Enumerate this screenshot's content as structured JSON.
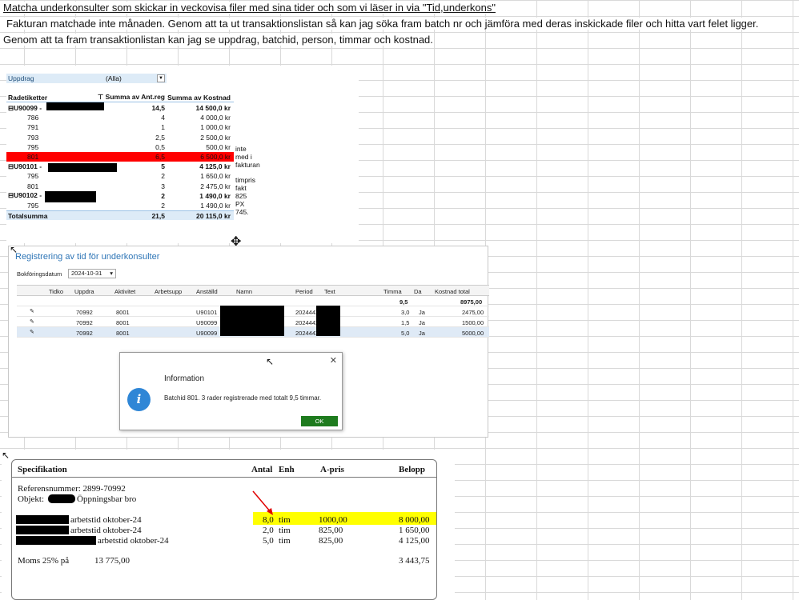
{
  "notes": {
    "line1": "Matcha underkonsulter som skickar  in veckovisa filer med sina tider  och som vi läser in  via \"Tid,underkons\"",
    "line2": "Fakturan matchade inte månaden.  Genom att ta ut transaktionslistan så kan jag söka fram batch nr och jämföra med deras inskickade filer och hitta vart felet ligger.",
    "line3": "Genom att ta fram transaktionlistan kan jag se uppdrag, batchid, person, timmar och kostnad."
  },
  "pivot": {
    "filter_label": "Uppdrag",
    "filter_value": "(Alla)",
    "headers": [
      "Radetiketter",
      "Summa av Ant.reg",
      "Summa av Kostnad"
    ],
    "rows": [
      {
        "label": "⊟U90099 -",
        "qty": "14,5",
        "cost": "14 500,0 kr",
        "type": "group",
        "note": ""
      },
      {
        "label": "786",
        "qty": "4",
        "cost": "4 000,0 kr",
        "type": "item",
        "note": ""
      },
      {
        "label": "791",
        "qty": "1",
        "cost": "1 000,0 kr",
        "type": "item",
        "note": ""
      },
      {
        "label": "793",
        "qty": "2,5",
        "cost": "2 500,0 kr",
        "type": "item",
        "note": ""
      },
      {
        "label": "795",
        "qty": "0,5",
        "cost": "500,0 kr",
        "type": "item",
        "note": ""
      },
      {
        "label": "801",
        "qty": "6,5",
        "cost": "6 500,0 kr",
        "type": "red",
        "note": "inte med i fakturan"
      },
      {
        "label": "⊟U90101 -",
        "qty": "5",
        "cost": "4 125,0 kr",
        "type": "group",
        "note": ""
      },
      {
        "label": "795",
        "qty": "2",
        "cost": "1 650,0 kr",
        "type": "item",
        "note": ""
      },
      {
        "label": "801",
        "qty": "3",
        "cost": "2 475,0 kr",
        "type": "item",
        "note": ""
      },
      {
        "label": "⊟U90102 -",
        "qty": "2",
        "cost": "1 490,0 kr",
        "type": "group",
        "note": "timpris fakt 825 PX 745."
      },
      {
        "label": "795",
        "qty": "2",
        "cost": "1 490,0 kr",
        "type": "item",
        "note": ""
      },
      {
        "label": "Totalsumma",
        "qty": "21,5",
        "cost": "20 115,0 kr",
        "type": "total",
        "note": ""
      }
    ]
  },
  "window": {
    "title": "Registrering av tid för underkonsulter",
    "date_label": "Bokföringsdatum",
    "date_value": "2024-10-31",
    "columns": [
      "Tidko",
      "Uppdra",
      "Aktivitet",
      "Arbetsupp",
      "Anställd",
      "Namn",
      "Period",
      "Text",
      "Timma",
      "Da",
      "Kostnad total"
    ],
    "summary": {
      "hours": "9,5",
      "cost": "8975,00"
    },
    "rows": [
      {
        "uppdrag": "70992",
        "aktivitet": "8001",
        "anstalld": "U90101",
        "period": "202444X",
        "timmar": "3,0",
        "da": "Ja",
        "kostnad": "2475,00"
      },
      {
        "uppdrag": "70992",
        "aktivitet": "8001",
        "anstalld": "U90099",
        "period": "202444X",
        "timmar": "1,5",
        "da": "Ja",
        "kostnad": "1500,00"
      },
      {
        "uppdrag": "70992",
        "aktivitet": "8001",
        "anstalld": "U90099",
        "period": "202444X",
        "timmar": "5,0",
        "da": "Ja",
        "kostnad": "5000,00"
      }
    ]
  },
  "dialog": {
    "title": "Information",
    "message": "Batchid 801. 3 rader registrerade med totalt 9,5 timmar.",
    "ok_label": "OK",
    "close": "✕",
    "icon": "i"
  },
  "invoice": {
    "headers": [
      "Specifikation",
      "Antal",
      "Enh",
      "A-pris",
      "Belopp"
    ],
    "ref": "Referensnummer: 2899-70992",
    "objekt_label": "Objekt:",
    "objekt_value": "Öppningsbar bro",
    "rows": [
      {
        "desc": "arbetstid oktober-24",
        "antal": "8,0",
        "enh": "tim",
        "apris": "1000,00",
        "belopp": "8 000,00",
        "highlight": true
      },
      {
        "desc": "arbetstid oktober-24",
        "antal": "2,0",
        "enh": "tim",
        "apris": "825,00",
        "belopp": "1 650,00",
        "highlight": false
      },
      {
        "desc": "arbetstid oktober-24",
        "antal": "5,0",
        "enh": "tim",
        "apris": "825,00",
        "belopp": "4 125,00",
        "highlight": false
      }
    ],
    "moms_label": "Moms 25% på",
    "moms_base": "13 775,00",
    "moms_amount": "3 443,75"
  },
  "colors": {
    "accent": "#2e75b6",
    "pivot_header": "#ddebf7",
    "alert_red": "#ff0000",
    "highlight_yellow": "#ffff00",
    "ok_green": "#1e7b1e",
    "info_blue": "#2f86d6"
  },
  "icons": [
    "dropdown-icon",
    "filter-icon",
    "pencil-icon",
    "info-icon",
    "close-icon",
    "move-cursor-icon",
    "pointer-cursor-icon",
    "red-arrow-icon"
  ]
}
